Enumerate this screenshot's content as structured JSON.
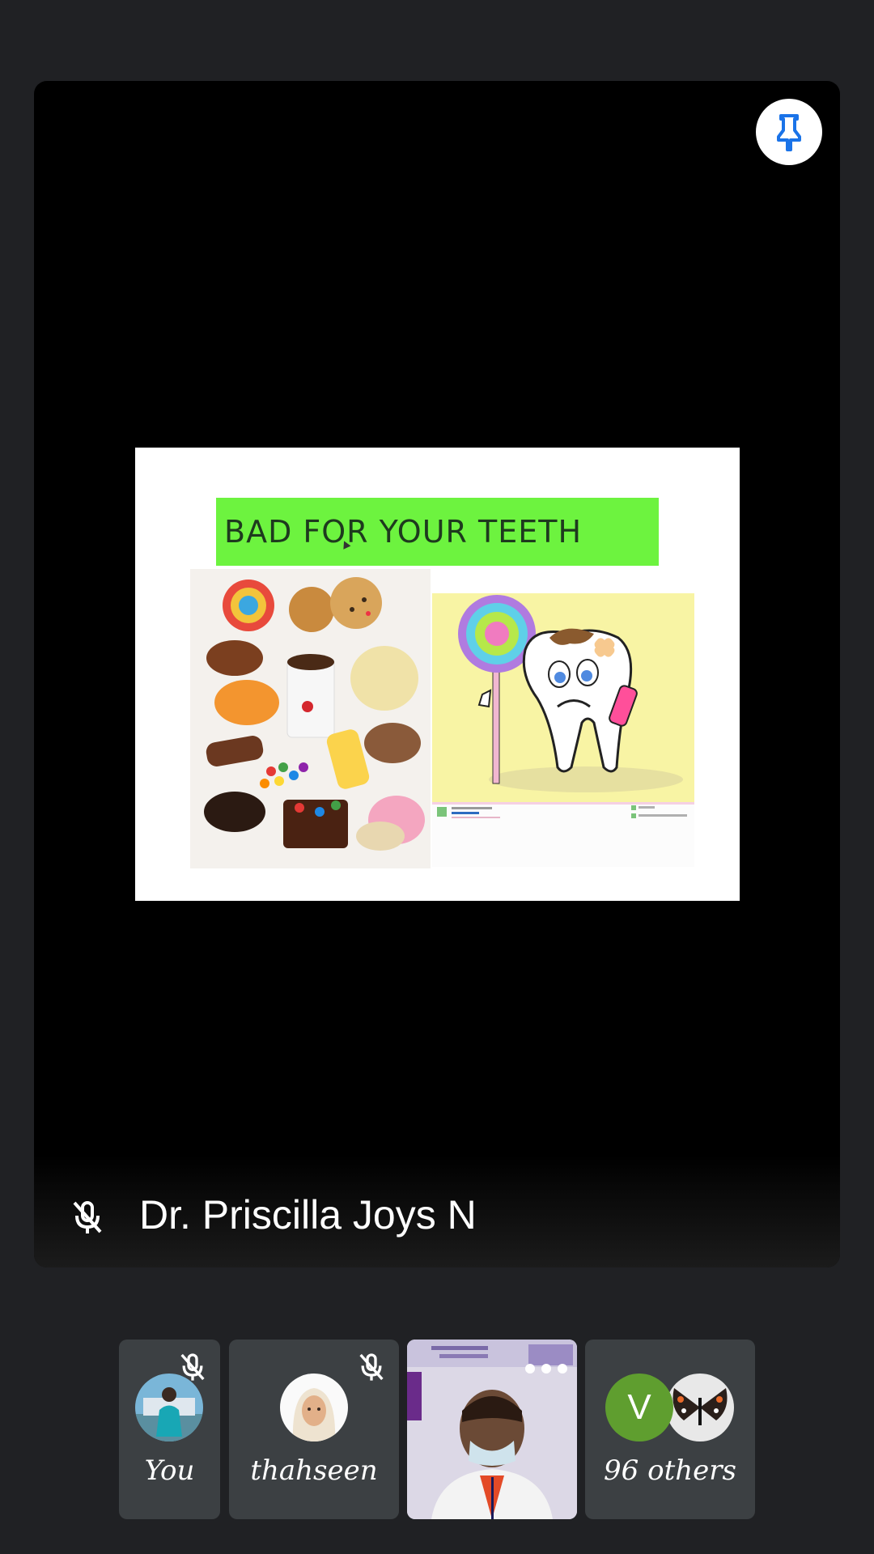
{
  "main": {
    "slide_title": "BAD FOR YOUR TEETH",
    "speaker_name": "Dr. Priscilla Joys N"
  },
  "participants": [
    {
      "name": "You",
      "muted": true
    },
    {
      "name": "thahseen",
      "muted": true
    },
    {
      "name": "",
      "video": true
    },
    {
      "name": "96 others",
      "avatar_letter": "V"
    }
  ],
  "colors": {
    "background": "#202124",
    "tile": "#3c4043",
    "slide_title_bg": "#6df33f",
    "pin_icon": "#1a73e8",
    "avatar_v": "#5f9e2f"
  },
  "icons": [
    "pin-icon",
    "mic-off-icon",
    "more-icon"
  ]
}
